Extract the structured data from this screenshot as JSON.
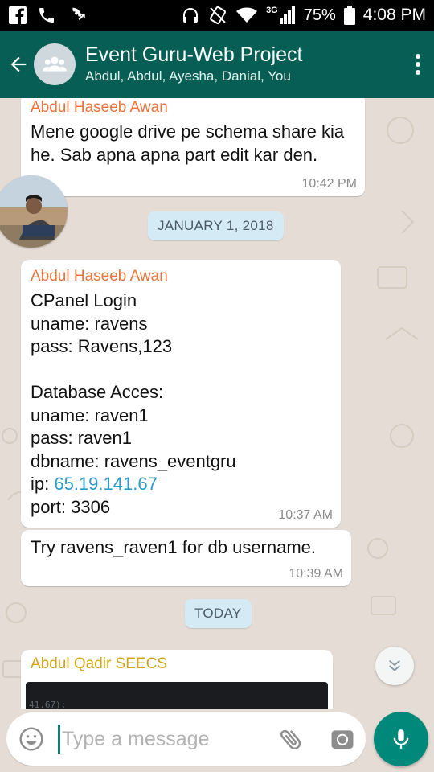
{
  "status_bar": {
    "battery": "75%",
    "time": "4:08 PM",
    "network": "3G",
    "icons": [
      "facebook-icon",
      "phone-icon",
      "missed-call-icon",
      "headphones-icon",
      "no-signal-icon",
      "wifi-icon",
      "signal-icon",
      "battery-icon"
    ]
  },
  "header": {
    "title": "Event Guru-Web Project",
    "subtitle": "Abdul, Abdul, Ayesha, Danial, You",
    "icons": [
      "back-arrow-icon",
      "group-icon",
      "more-vert-icon"
    ]
  },
  "messages": [
    {
      "sender": "Abdul Haseeb Awan",
      "text": "Mene google drive pe schema share kia he. Sab apna apna part edit kar den.",
      "time": "10:42 PM"
    },
    {
      "date": "JANUARY 1, 2018"
    },
    {
      "sender": "Abdul Haseeb Awan",
      "text_before_link": "CPanel Login\nuname: ravens\npass: Ravens,123\n\nDatabase Acces:\nuname: raven1\npass: raven1\ndbname: ravens_eventgru\nip: ",
      "link": "65.19.141.67",
      "text_after_link": "\nport: 3306",
      "time": "10:37 AM"
    },
    {
      "text": "Try ravens_raven1 for db username.",
      "time": "10:39 AM"
    },
    {
      "date": "TODAY"
    },
    {
      "sender": "Abdul Qadir SEECS",
      "preview_text": "41.67):"
    }
  ],
  "input": {
    "placeholder": "Type a message"
  },
  "colors": {
    "header": "#075e54",
    "sender_awan": "#e8743b",
    "sender_qadir": "#d1a619",
    "link": "#2a9bc8",
    "mic": "#00897b",
    "date_chip": "#d4eaf4"
  }
}
